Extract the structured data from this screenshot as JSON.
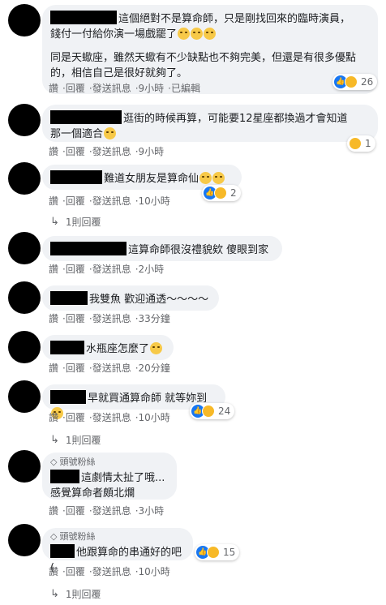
{
  "actions": {
    "like": "讚",
    "reply": "回覆",
    "message": "發送訊息",
    "sep": "·"
  },
  "comments": [
    {
      "lines": [
        "這個絕對不是算命師，只是剛找回來的臨時演員，",
        "錢付一付給你演一場戲罷了"
      ],
      "extra": "同是天蠍座，雖然天蠍有不少缺點也不夠完美，但還是有很多優點的，相信自己是很好就夠了。",
      "time": "9小時",
      "edited": "已編輯",
      "reactions": "26"
    },
    {
      "lines": [
        "逛街的時候再算，可能要12星座都換過才會知道",
        "那一個適合"
      ],
      "time": "9小時",
      "reactions": "1"
    },
    {
      "lines": [
        "難道女朋友是算命仙"
      ],
      "time": "10小時",
      "reactions": "2",
      "replies": "1則回覆"
    },
    {
      "lines": [
        "這算命師很沒禮貌欸 傻眼到家"
      ],
      "time": "2小時"
    },
    {
      "lines": [
        "我雙魚 歡迎通透～～～～"
      ],
      "time": "33分鐘"
    },
    {
      "lines": [
        "水瓶座怎麼了"
      ],
      "time": "20分鐘"
    },
    {
      "lines": [
        "早就買通算命師 就等妳到"
      ],
      "time": "10小時",
      "reactions": "24",
      "replies": "1則回覆"
    },
    {
      "badge": "頭號粉絲",
      "lines": [
        "這劇情太扯了哦...",
        "感覺算命者頗北爛"
      ],
      "time": "3小時"
    },
    {
      "badge": "頭號粉絲",
      "lines": [
        "他跟算命的串通好的吧("
      ],
      "time": "10小時",
      "reactions": "15",
      "replies": "1則回覆"
    }
  ]
}
